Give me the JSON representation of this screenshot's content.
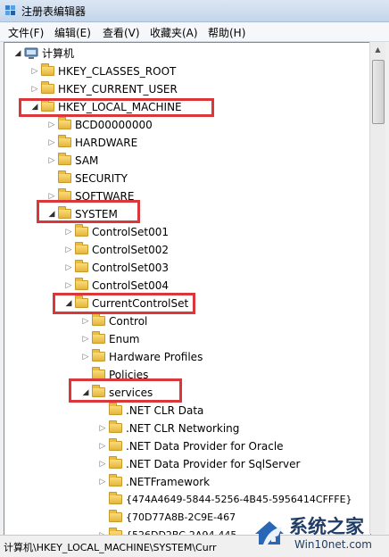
{
  "window": {
    "title": "注册表编辑器"
  },
  "menu": [
    "文件(F)",
    "编辑(E)",
    "查看(V)",
    "收藏夹(A)",
    "帮助(H)"
  ],
  "tree": [
    {
      "label": "计算机",
      "level": 0,
      "expander": "open",
      "icon": "computer-icon"
    },
    {
      "label": "HKEY_CLASSES_ROOT",
      "level": 1,
      "expander": "closed",
      "icon": "folder-icon"
    },
    {
      "label": "HKEY_CURRENT_USER",
      "level": 1,
      "expander": "closed",
      "icon": "folder-icon"
    },
    {
      "label": "HKEY_LOCAL_MACHINE",
      "level": 1,
      "expander": "open",
      "icon": "folder-icon",
      "highlighted": true
    },
    {
      "label": "BCD00000000",
      "level": 2,
      "expander": "closed",
      "icon": "folder-icon"
    },
    {
      "label": "HARDWARE",
      "level": 2,
      "expander": "closed",
      "icon": "folder-icon"
    },
    {
      "label": "SAM",
      "level": 2,
      "expander": "closed",
      "icon": "folder-icon"
    },
    {
      "label": "SECURITY",
      "level": 2,
      "expander": "none",
      "icon": "folder-icon"
    },
    {
      "label": "SOFTWARE",
      "level": 2,
      "expander": "closed",
      "icon": "folder-icon"
    },
    {
      "label": "SYSTEM",
      "level": 2,
      "expander": "open",
      "icon": "folder-icon",
      "highlighted": true
    },
    {
      "label": "ControlSet001",
      "level": 3,
      "expander": "closed",
      "icon": "folder-icon"
    },
    {
      "label": "ControlSet002",
      "level": 3,
      "expander": "closed",
      "icon": "folder-icon"
    },
    {
      "label": "ControlSet003",
      "level": 3,
      "expander": "closed",
      "icon": "folder-icon"
    },
    {
      "label": "ControlSet004",
      "level": 3,
      "expander": "closed",
      "icon": "folder-icon"
    },
    {
      "label": "CurrentControlSet",
      "level": 3,
      "expander": "open",
      "icon": "folder-icon",
      "highlighted": true
    },
    {
      "label": "Control",
      "level": 4,
      "expander": "closed",
      "icon": "folder-icon"
    },
    {
      "label": "Enum",
      "level": 4,
      "expander": "closed",
      "icon": "folder-icon"
    },
    {
      "label": "Hardware Profiles",
      "level": 4,
      "expander": "closed",
      "icon": "folder-icon"
    },
    {
      "label": "Policies",
      "level": 4,
      "expander": "none",
      "icon": "folder-icon"
    },
    {
      "label": "services",
      "level": 4,
      "expander": "open",
      "icon": "folder-icon",
      "highlighted": true
    },
    {
      "label": ".NET CLR Data",
      "level": 5,
      "expander": "none",
      "icon": "folder-icon"
    },
    {
      "label": ".NET CLR Networking",
      "level": 5,
      "expander": "closed",
      "icon": "folder-icon"
    },
    {
      "label": ".NET Data Provider for Oracle",
      "level": 5,
      "expander": "closed",
      "icon": "folder-icon"
    },
    {
      "label": ".NET Data Provider for SqlServer",
      "level": 5,
      "expander": "closed",
      "icon": "folder-icon"
    },
    {
      "label": ".NETFramework",
      "level": 5,
      "expander": "closed",
      "icon": "folder-icon"
    },
    {
      "label": "{474A4649-5844-5256-4B45-5956414CFFFE}",
      "level": 5,
      "expander": "none",
      "icon": "folder-icon",
      "small": true
    },
    {
      "label": "{70D77A8B-2C9E-467",
      "level": 5,
      "expander": "none",
      "icon": "folder-icon",
      "small": true
    },
    {
      "label": "{526DD2BC-2A94-445",
      "level": 5,
      "expander": "closed",
      "icon": "folder-icon",
      "small": true
    }
  ],
  "status": {
    "path": "计算机\\HKEY_LOCAL_MACHINE\\SYSTEM\\Curr"
  },
  "watermark": {
    "name": "系统之家",
    "site": "Win10net.com"
  },
  "colors": {
    "highlight": "#d9373a",
    "folder": "#f1cc5c",
    "watermark": "#1f3d66"
  }
}
